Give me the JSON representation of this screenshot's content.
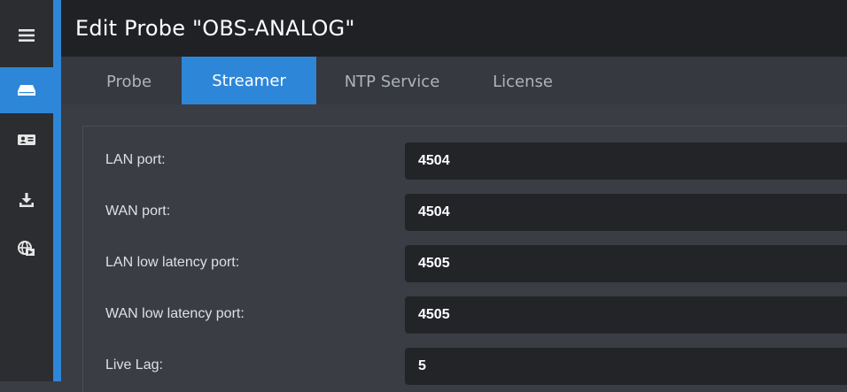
{
  "header": {
    "title": "Edit Probe \"OBS-ANALOG\""
  },
  "sidebar": {
    "items": [
      {
        "icon": "hamburger-menu-icon"
      },
      {
        "icon": "hard-drive-icon"
      },
      {
        "icon": "id-card-icon"
      },
      {
        "icon": "download-icon"
      },
      {
        "icon": "globe-media-icon"
      }
    ],
    "active_index": 1
  },
  "tabs": [
    {
      "label": "Probe"
    },
    {
      "label": "Streamer"
    },
    {
      "label": "NTP Service"
    },
    {
      "label": "License"
    }
  ],
  "active_tab": "Streamer",
  "form": {
    "fields": [
      {
        "label": "LAN port:",
        "value": "4504"
      },
      {
        "label": "WAN port:",
        "value": "4504"
      },
      {
        "label": "LAN low latency port:",
        "value": "4505"
      },
      {
        "label": "WAN low latency port:",
        "value": "4505"
      },
      {
        "label": "Live Lag:",
        "value": "5"
      }
    ]
  },
  "colors": {
    "accent": "#2e86d8",
    "sidebar_bg": "#2b2d31",
    "header_bg": "#202125",
    "content_bg": "#3a3d43",
    "input_bg": "#232428"
  }
}
